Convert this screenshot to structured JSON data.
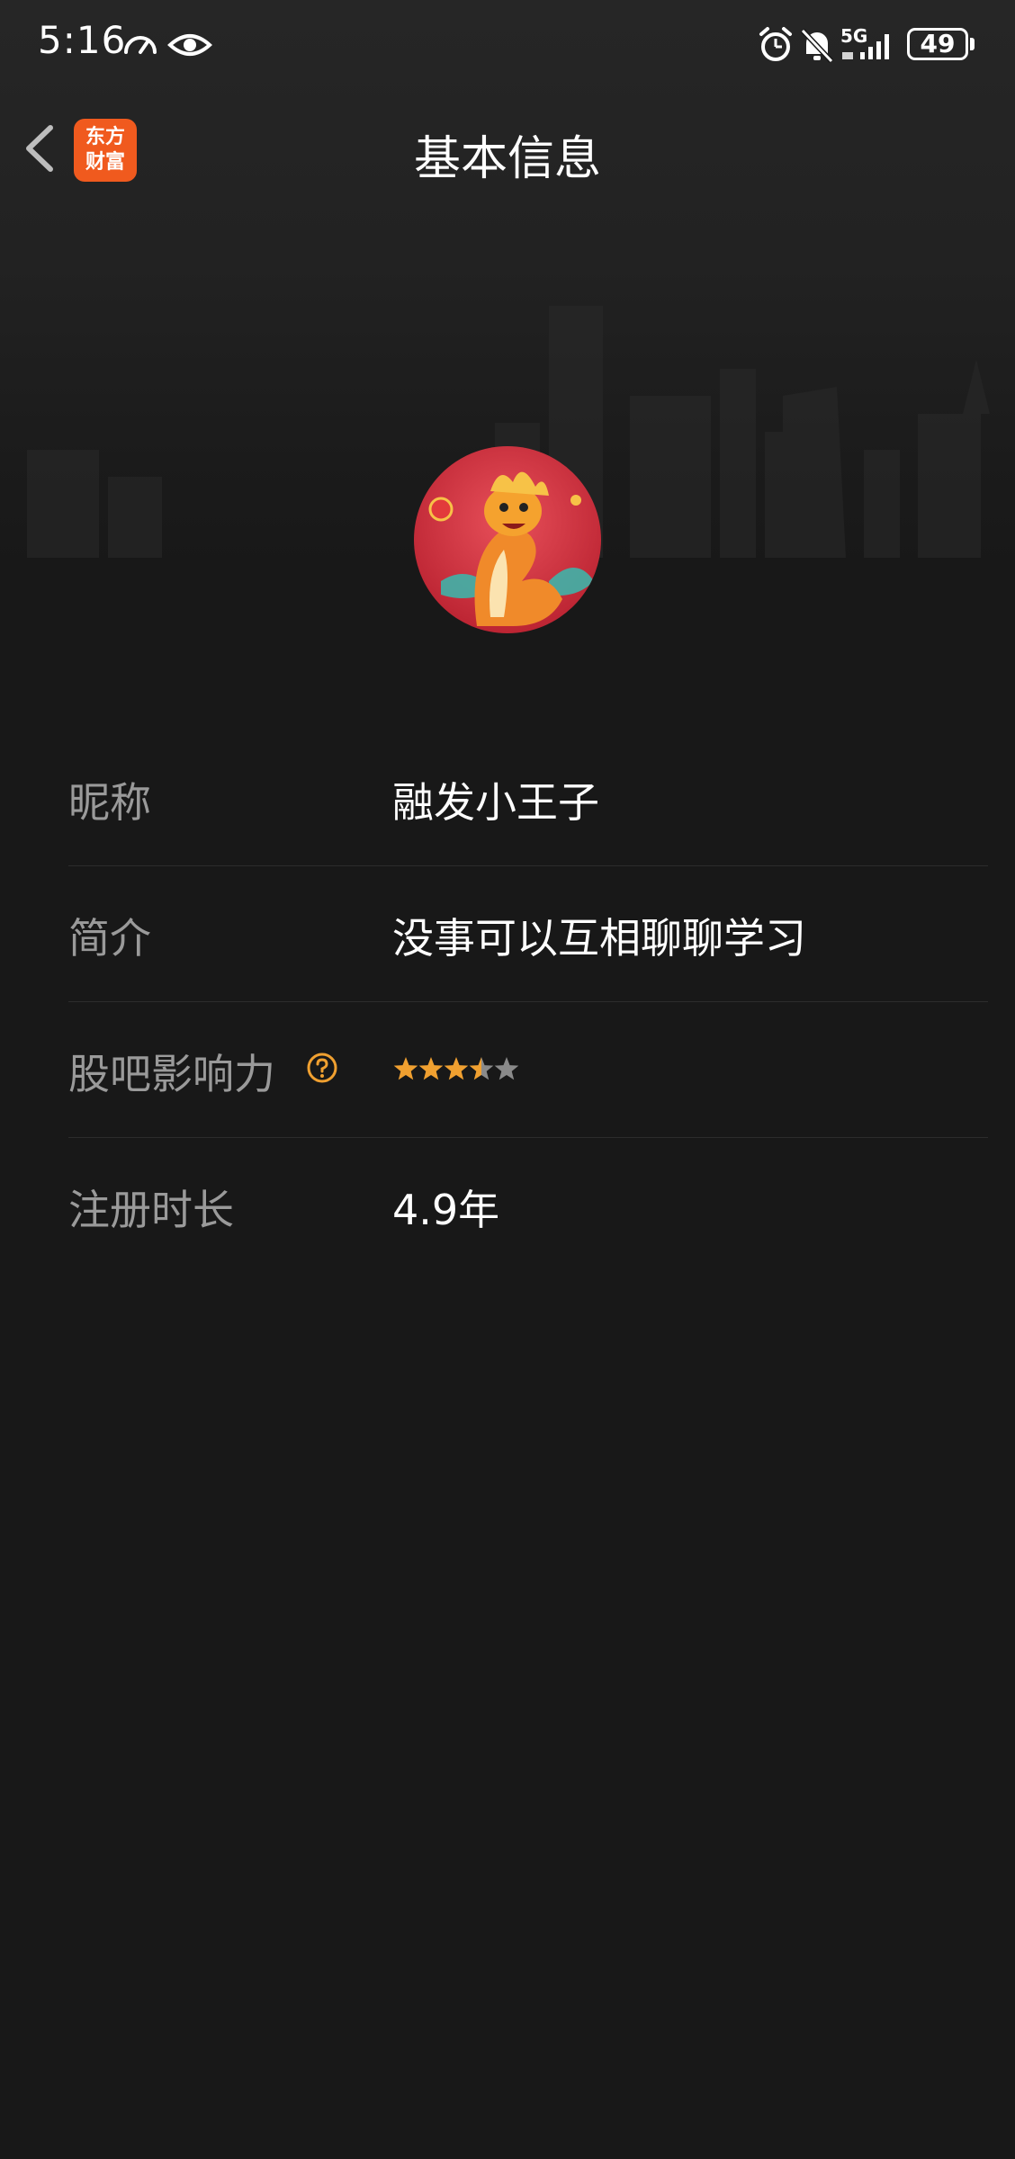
{
  "status_bar": {
    "time": "5:16",
    "network": "5G",
    "battery": "49"
  },
  "header": {
    "logo_line1": "东方",
    "logo_line2": "财富",
    "title": "基本信息"
  },
  "profile": {
    "rows": [
      {
        "label": "昵称",
        "value": "融发小王子"
      },
      {
        "label": "简介",
        "value": "没事可以互相聊聊学习"
      },
      {
        "label": "股吧影响力",
        "rating": 3.5,
        "max_rating": 5
      },
      {
        "label": "注册时长",
        "value": "4.9年"
      }
    ]
  },
  "colors": {
    "background": "#181818",
    "accent": "#f0a030",
    "brand": "#f05a1e",
    "label": "#9a9a9a",
    "divider": "#2c2c2c"
  },
  "icons": {
    "back": "chevron-left-icon",
    "help": "question-circle-icon",
    "alarm": "alarm-clock-icon",
    "mute": "bell-off-icon",
    "speed": "speedometer-icon",
    "eye": "eye-icon",
    "signal": "signal-bars-icon"
  }
}
